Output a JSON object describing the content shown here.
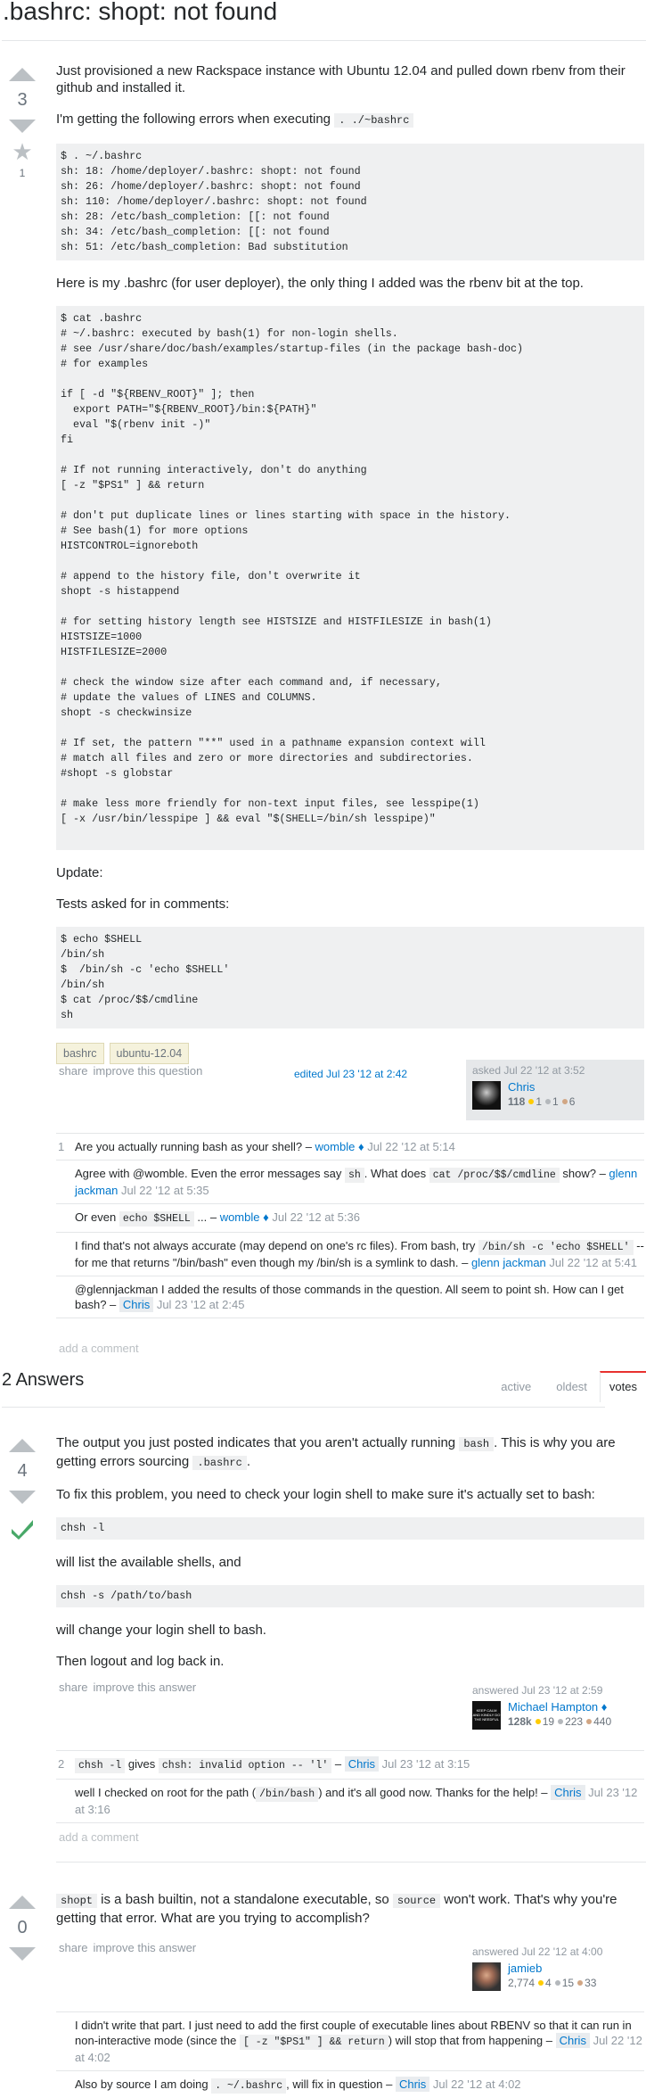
{
  "question": {
    "title": ".bashrc: shopt: not found",
    "votes": "3",
    "favorites": "1",
    "p1": "Just provisioned a new Rackspace instance with Ubuntu 12.04 and pulled down rbenv from their github and installed it.",
    "p2": "I'm getting the following errors when executing",
    "p2_code": ". ./~bashrc",
    "code1": "$ . ~/.bashrc\nsh: 18: /home/deployer/.bashrc: shopt: not found\nsh: 26: /home/deployer/.bashrc: shopt: not found\nsh: 110: /home/deployer/.bashrc: shopt: not found\nsh: 28: /etc/bash_completion: [[: not found\nsh: 34: /etc/bash_completion: [[: not found\nsh: 51: /etc/bash_completion: Bad substitution",
    "p3": "Here is my .bashrc (for user deployer), the only thing I added was the rbenv bit at the top.",
    "code2": "$ cat .bashrc\n# ~/.bashrc: executed by bash(1) for non-login shells.\n# see /usr/share/doc/bash/examples/startup-files (in the package bash-doc)\n# for examples\n\nif [ -d \"${RBENV_ROOT}\" ]; then\n  export PATH=\"${RBENV_ROOT}/bin:${PATH}\"\n  eval \"$(rbenv init -)\"\nfi\n\n# If not running interactively, don't do anything\n[ -z \"$PS1\" ] && return\n\n# don't put duplicate lines or lines starting with space in the history.\n# See bash(1) for more options\nHISTCONTROL=ignoreboth\n\n# append to the history file, don't overwrite it\nshopt -s histappend\n\n# for setting history length see HISTSIZE and HISTFILESIZE in bash(1)\nHISTSIZE=1000\nHISTFILESIZE=2000\n\n# check the window size after each command and, if necessary,\n# update the values of LINES and COLUMNS.\nshopt -s checkwinsize\n\n# If set, the pattern \"**\" used in a pathname expansion context will\n# match all files and zero or more directories and subdirectories.\n#shopt -s globstar\n\n# make less more friendly for non-text input files, see lesspipe(1)\n[ -x /usr/bin/lesspipe ] && eval \"$(SHELL=/bin/sh lesspipe)\"",
    "p4": "Update:",
    "p5": "Tests asked for in comments:",
    "code3": "$ echo $SHELL\n/bin/sh\n$  /bin/sh -c 'echo $SHELL'\n/bin/sh\n$ cat /proc/$$/cmdline\nsh",
    "tags": [
      "bashrc",
      "ubuntu-12.04"
    ],
    "share": "share",
    "improve": "improve this question",
    "edited": "edited Jul 23 '12 at 2:42",
    "asked": "asked Jul 22 '12 at 3:52",
    "user": {
      "name": "Chris",
      "rep": "118",
      "gold": "1",
      "silver": "1",
      "bronze": "6"
    },
    "add_comment": "add a comment"
  },
  "question_comments": [
    {
      "score": "1",
      "parts": [
        [
          "t",
          "Are you actually running bash as your shell? – "
        ],
        [
          "l",
          "womble ♦"
        ],
        [
          "d",
          " Jul 22 '12 at 5:14"
        ]
      ]
    },
    {
      "score": "",
      "parts": [
        [
          "t",
          "Agree with @womble. Even the error messages say "
        ],
        [
          "c",
          "sh"
        ],
        [
          "t",
          ". What does "
        ],
        [
          "c",
          "cat /proc/$$/cmdline"
        ],
        [
          "t",
          " show? – "
        ],
        [
          "l",
          "glenn jackman"
        ],
        [
          "d",
          " Jul 22 '12 at 5:35"
        ]
      ]
    },
    {
      "score": "",
      "parts": [
        [
          "t",
          "Or even "
        ],
        [
          "c",
          "echo $SHELL"
        ],
        [
          "t",
          " ... – "
        ],
        [
          "l",
          "womble ♦"
        ],
        [
          "d",
          " Jul 22 '12 at 5:36"
        ]
      ]
    },
    {
      "score": "",
      "parts": [
        [
          "t",
          "I find that's not always accurate (may depend on one's rc files). From bash, try "
        ],
        [
          "c",
          "/bin/sh -c 'echo $SHELL'"
        ],
        [
          "t",
          " -- for me that returns \"/bin/bash\" even though my /bin/sh is a symlink to dash. – "
        ],
        [
          "l",
          "glenn jackman"
        ],
        [
          "d",
          " Jul 22 '12 at 5:41"
        ]
      ]
    },
    {
      "score": "",
      "parts": [
        [
          "t",
          "@glennjackman I added the results of those commands in the question. All seem to point sh. How can I get bash? – "
        ],
        [
          "o",
          "Chris"
        ],
        [
          "d",
          " Jul 23 '12 at 2:45"
        ]
      ]
    }
  ],
  "answers_header": {
    "count": "2 Answers",
    "tabs": [
      "active",
      "oldest",
      "votes"
    ],
    "active_tab": "votes",
    "accent": "#f48024"
  },
  "answer1": {
    "votes": "4",
    "accepted": true,
    "p1a": "The output you just posted indicates that you aren't actually running ",
    "c1": "bash",
    "p1b": ". This is why you are getting errors sourcing ",
    "c2": ".bashrc",
    "p1c": ".",
    "p2": "To fix this problem, you need to check your login shell to make sure it's actually set to bash:",
    "code1": "chsh -l",
    "p3": "will list the available shells, and",
    "code2": "chsh -s /path/to/bash",
    "p4": "will change your login shell to bash.",
    "p5": "Then logout and log back in.",
    "share": "share",
    "improve": "improve this answer",
    "answered": "answered Jul 23 '12 at 2:59",
    "user": {
      "name": "Michael Hampton ♦",
      "rep": "128k",
      "gold": "19",
      "silver": "223",
      "bronze": "440",
      "avatar_text": "KEEP CALM AND KINDLY DO THE NEEDFUL"
    },
    "add_comment": "add a comment"
  },
  "answer1_comments": [
    {
      "score": "2",
      "parts": [
        [
          "c",
          "chsh -l"
        ],
        [
          "t",
          " gives "
        ],
        [
          "c",
          "chsh: invalid option -- 'l'"
        ],
        [
          "t",
          " – "
        ],
        [
          "o",
          "Chris"
        ],
        [
          "d",
          " Jul 23 '12 at 3:15"
        ]
      ]
    },
    {
      "score": "",
      "parts": [
        [
          "t",
          "well I checked on root for the path ("
        ],
        [
          "c",
          "/bin/bash"
        ],
        [
          "t",
          ") and it's all good now. Thanks for the help! – "
        ],
        [
          "o",
          "Chris"
        ],
        [
          "d",
          " Jul 23 '12 at 3:16"
        ]
      ]
    }
  ],
  "answer2": {
    "votes": "0",
    "c1": "shopt",
    "p1a": " is a bash builtin, not a standalone executable, so ",
    "c2": "source",
    "p1b": " won't work. That's why you're getting that error. What are you trying to accomplish?",
    "share": "share",
    "improve": "improve this answer",
    "answered": "answered Jul 22 '12 at 4:00",
    "user": {
      "name": "jamieb",
      "rep": "2,774",
      "gold": "4",
      "silver": "15",
      "bronze": "33"
    }
  },
  "answer2_comments": [
    {
      "score": "",
      "parts": [
        [
          "t",
          "I didn't write that part. I just need to add the first couple of executable lines about RBENV so that it can run in non-interactive mode (since the "
        ],
        [
          "c",
          "[ -z \"$PS1\" ] && return"
        ],
        [
          "t",
          ") will stop that from happening – "
        ],
        [
          "o",
          "Chris"
        ],
        [
          "d",
          " Jul 22 '12 at 4:02"
        ]
      ]
    },
    {
      "score": "",
      "parts": [
        [
          "t",
          "Also by source I am doing "
        ],
        [
          "c",
          ". ~/.bashrc"
        ],
        [
          "t",
          ", will fix in question – "
        ],
        [
          "o",
          "Chris"
        ],
        [
          "d",
          " Jul 22 '12 at 4:02"
        ]
      ]
    }
  ],
  "colors": {
    "link": "#0077cc",
    "accepted": "#48a868",
    "code_bg": "#eff0f1",
    "gold": "#ffcc01",
    "silver": "#b4b8bc",
    "bronze": "#d1a684"
  }
}
